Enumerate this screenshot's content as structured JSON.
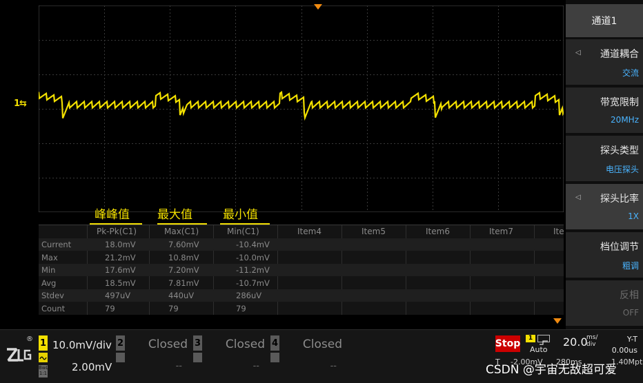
{
  "annotations": [
    "峰峰值",
    "最大值",
    "最小值"
  ],
  "measurement_table": {
    "columns": [
      "Pk-Pk(C1)",
      "Max(C1)",
      "Min(C1)",
      "Item4",
      "Item5",
      "Item6",
      "Item7",
      "Ite"
    ],
    "rows": [
      {
        "label": "Current",
        "values": [
          "18.0mV",
          "7.60mV",
          "-10.4mV"
        ]
      },
      {
        "label": "Max",
        "values": [
          "21.2mV",
          "10.8mV",
          "-10.0mV"
        ]
      },
      {
        "label": "Min",
        "values": [
          "17.6mV",
          "7.20mV",
          "-11.2mV"
        ]
      },
      {
        "label": "Avg",
        "values": [
          "18.5mV",
          "7.81mV",
          "-10.7mV"
        ]
      },
      {
        "label": "Stdev",
        "values": [
          "497uV",
          "440uV",
          "286uV"
        ]
      },
      {
        "label": "Count",
        "values": [
          "79",
          "79",
          "79"
        ]
      }
    ]
  },
  "side_menu": {
    "title": "通道1",
    "items": [
      {
        "label": "通道耦合",
        "value": "交流",
        "arrow": "◁"
      },
      {
        "label": "带宽限制",
        "value": "20MHz",
        "arrow": ""
      },
      {
        "label": "探头类型",
        "value": "电压探头",
        "arrow": ""
      },
      {
        "label": "探头比率",
        "value": "1X",
        "arrow": "◁"
      },
      {
        "label": "档位调节",
        "value": "粗调",
        "arrow": ""
      },
      {
        "label": "反相",
        "value": "OFF",
        "arrow": ""
      }
    ]
  },
  "channel_marker": "1⇆",
  "logo": {
    "text": "ZLG",
    "reg": "®"
  },
  "channels": [
    {
      "num": "1",
      "scale": "10.0mV/div",
      "offset": "2.00mV",
      "bw": "BwL\n1:1"
    },
    {
      "num": "2",
      "scale": "Closed",
      "offset": "--"
    },
    {
      "num": "3",
      "scale": "Closed",
      "offset": "--"
    },
    {
      "num": "4",
      "scale": "Closed",
      "offset": "--"
    }
  ],
  "acquisition": {
    "run_state": "Stop",
    "trigger_source": "1",
    "trigger_mode": "Auto",
    "timebase_value": "20.0",
    "timebase_unit_top": "ms/",
    "timebase_unit_bottom": "div",
    "mode": "Y-T",
    "h_offset": "0.00us",
    "t_label": "T",
    "trigger_level": "-2.00mV",
    "h_position": "280ms",
    "sample_rate": "1.40Mpts"
  },
  "colors": {
    "trace": "#f3e000",
    "trigger_marker": "#f08a10",
    "value_blue": "#4ab4ff",
    "stop": "#cc0000"
  },
  "watermark": "CSDN @宇宙无敌超可爱"
}
